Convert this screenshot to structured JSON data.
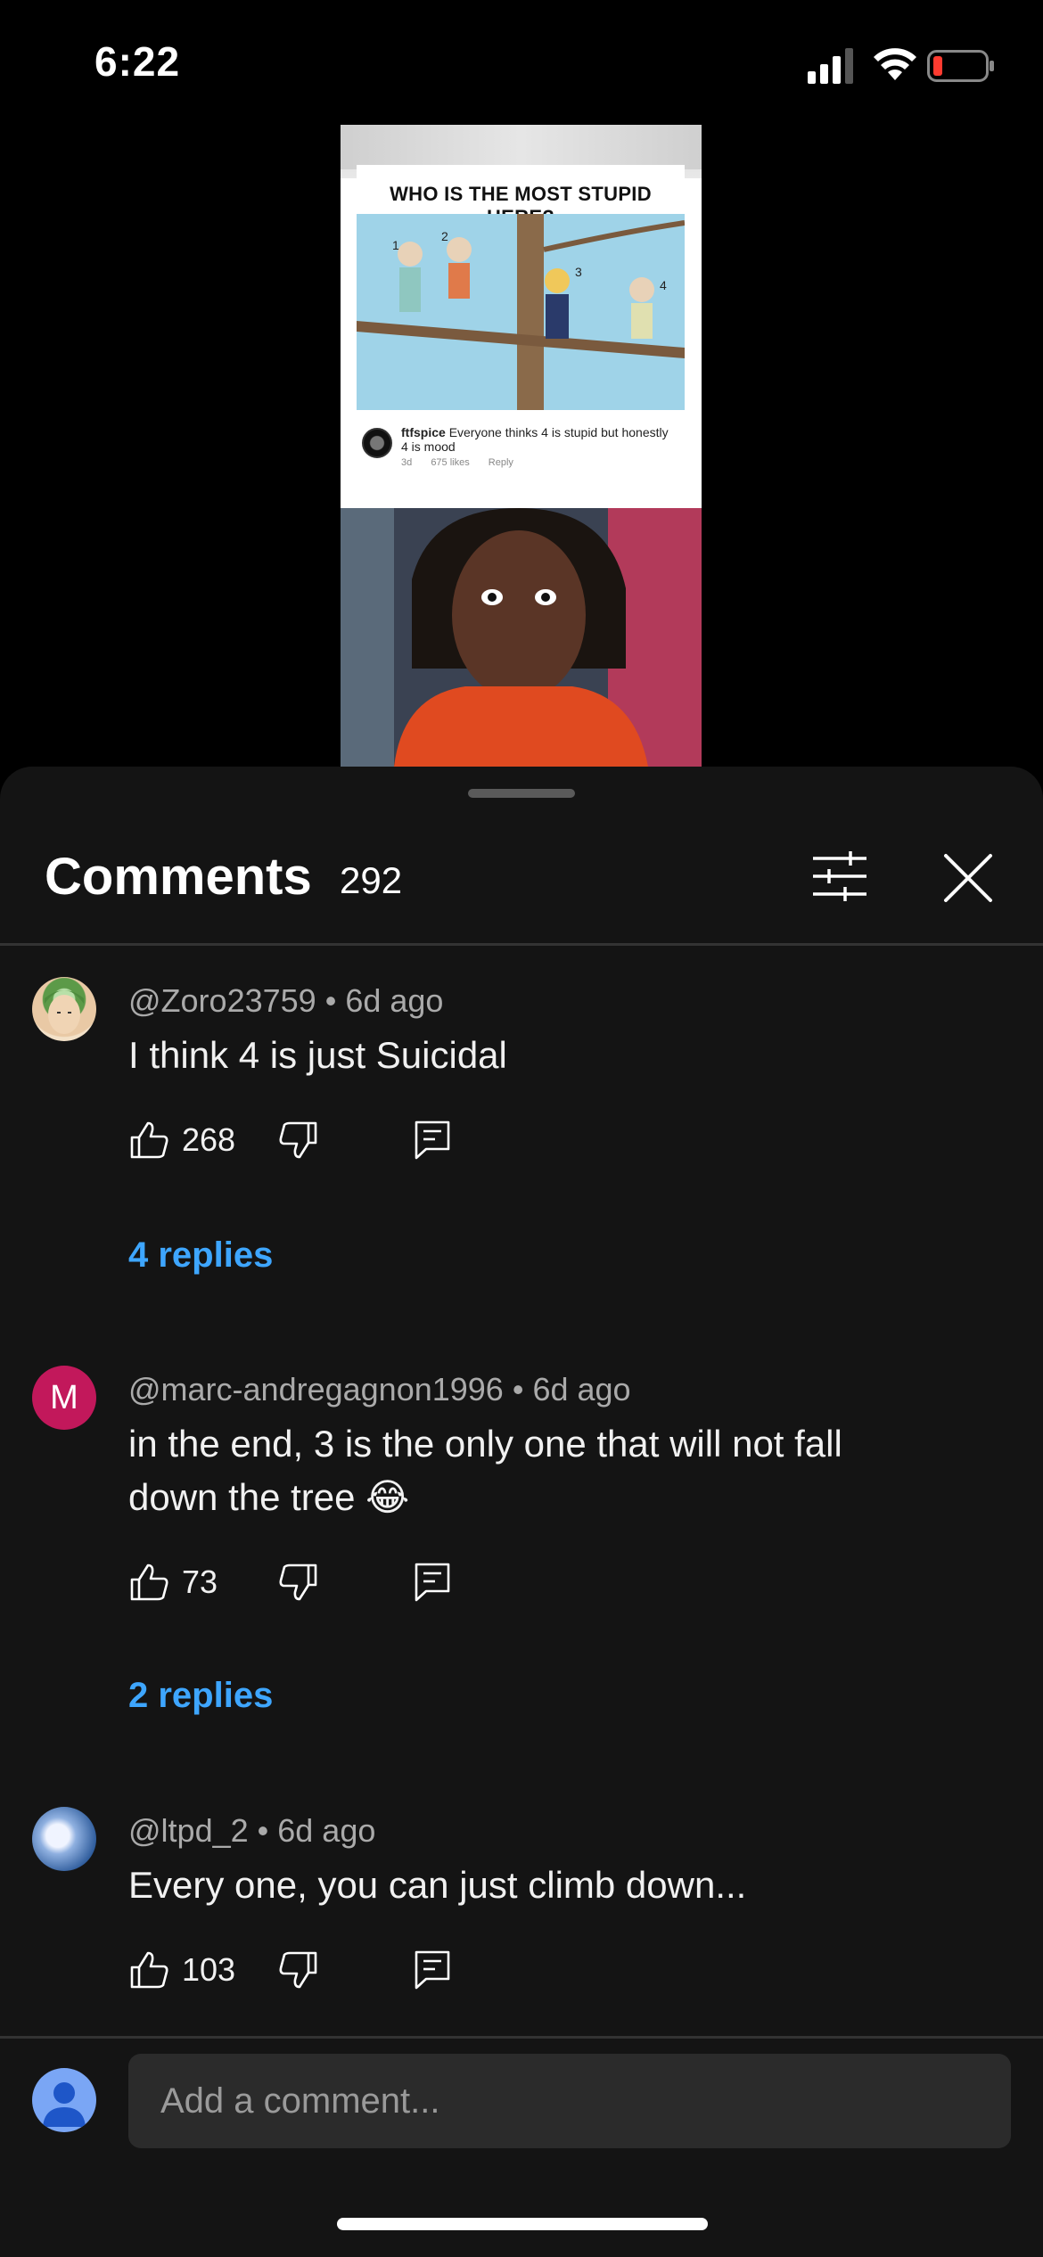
{
  "status": {
    "time": "6:22"
  },
  "video": {
    "meme_title": "WHO IS THE MOST STUPID HERE?",
    "labels": [
      "1",
      "2",
      "3",
      "4"
    ],
    "overlay_user": "ftfspice",
    "overlay_text": "Everyone thinks 4 is stupid but honestly 4 is mood",
    "overlay_meta": [
      "3d",
      "675 likes",
      "Reply"
    ]
  },
  "sheet": {
    "title": "Comments",
    "count": "292",
    "filter_icon": "sliders-icon",
    "close_icon": "close-icon"
  },
  "comments": [
    {
      "author": "@Zoro23759",
      "time": "6d ago",
      "text": "I think 4 is just Suicidal",
      "likes": "268",
      "replies": "4 replies",
      "avatar": "anime-avatar"
    },
    {
      "author": "@marc-andregagnon1996",
      "time": "6d ago",
      "text": "in the end, 3 is the only one that will not fall down the tree 😂",
      "likes": "73",
      "replies": "2 replies",
      "avatar_letter": "M",
      "avatar_color": "#c2185b"
    },
    {
      "author": "@ltpd_2",
      "time": "6d ago",
      "text": "Every one, you can just climb down...",
      "likes": "103",
      "avatar": "sky-avatar"
    }
  ],
  "composer": {
    "placeholder": "Add a comment..."
  },
  "colors": {
    "accent_link": "#3ea6ff",
    "sheet_bg": "#141414",
    "input_bg": "#2b2b2b"
  }
}
